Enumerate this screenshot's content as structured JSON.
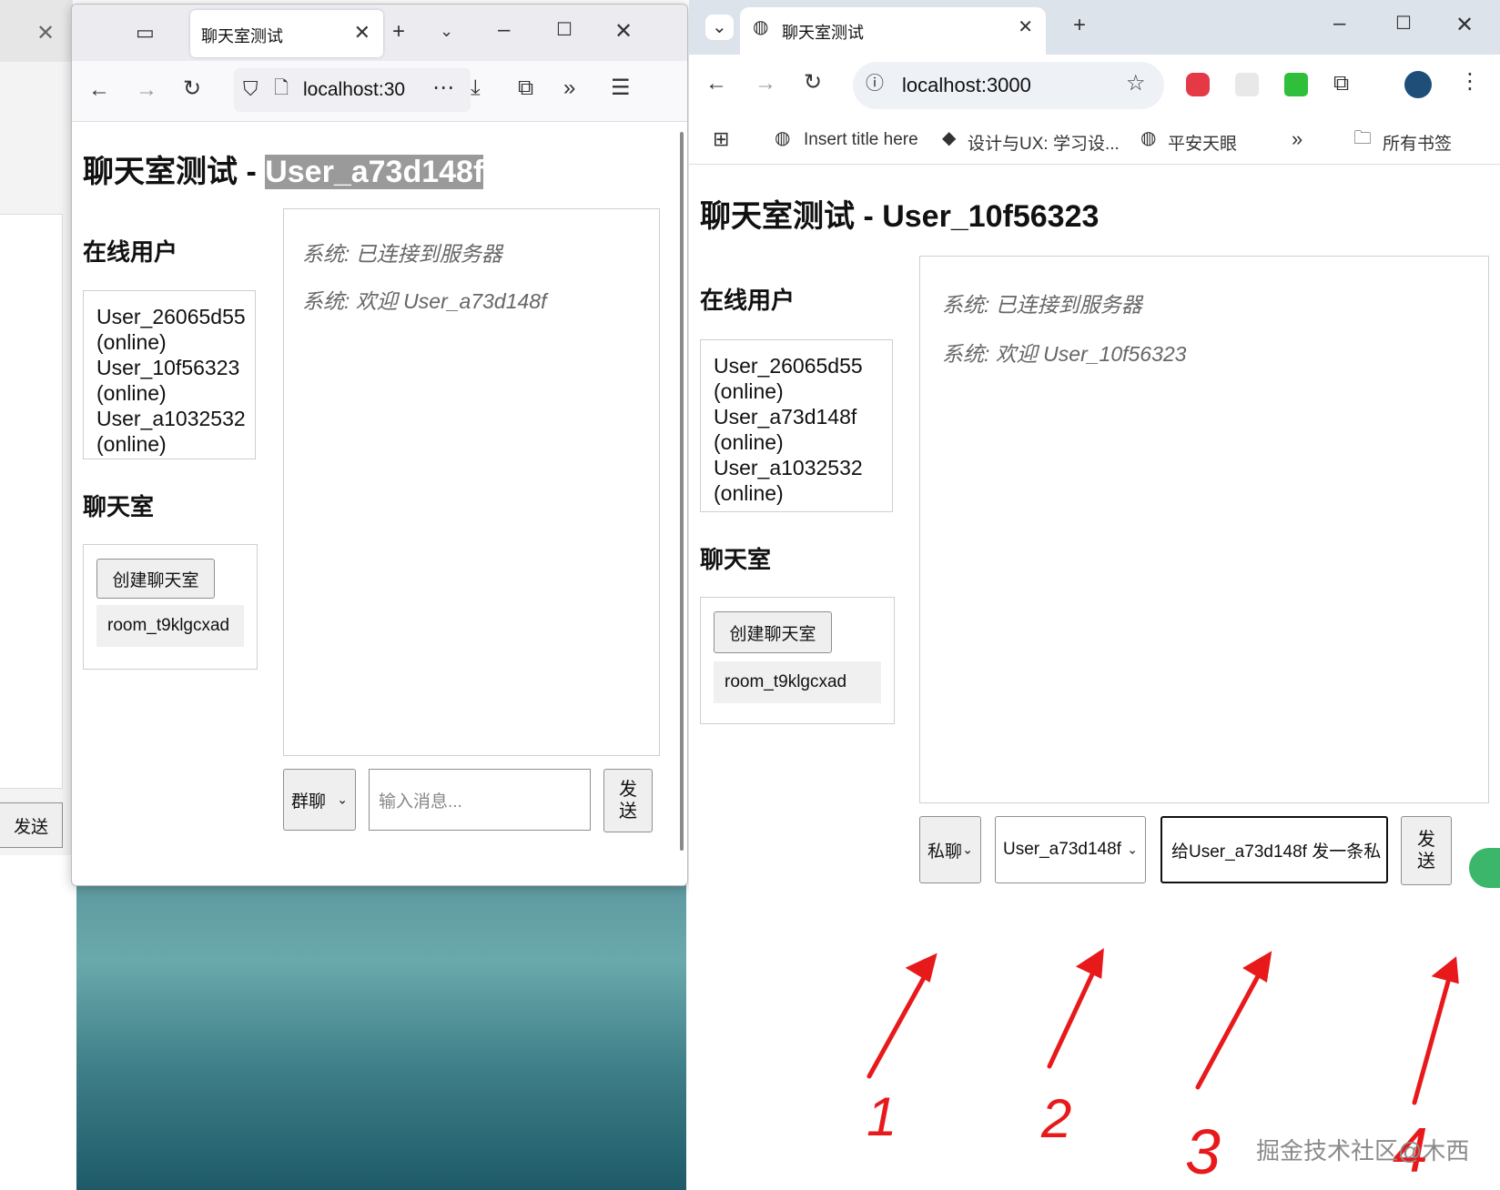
{
  "left_window": {
    "tab_title": "聊天室测试",
    "url_text": "localhost:30",
    "page": {
      "heading_prefix": "聊天室测试 - ",
      "heading_user": "User_a73d148f",
      "online_title": "在线用户",
      "users": [
        "User_26065d55",
        "(online)",
        "User_10f56323",
        "(online)",
        "User_a1032532",
        "(online)"
      ],
      "rooms_title": "聊天室",
      "create_room_label": "创建聊天室",
      "room_name": "room_t9klgcxad",
      "messages": [
        "系统: 已连接到服务器",
        "系统: 欢迎 User_a73d148f"
      ],
      "chat_mode": "群聊",
      "input_placeholder": "输入消息...",
      "send_label_1": "发",
      "send_label_2": "送"
    }
  },
  "background_window": {
    "send_label": "发送"
  },
  "right_window": {
    "tab_title": "聊天室测试",
    "url_text": "localhost:3000",
    "bookmarks": [
      "Insert title here",
      "设计与UX: 学习设...",
      "平安天眼"
    ],
    "all_bookmarks": "所有书签",
    "page": {
      "heading": "聊天室测试 - User_10f56323",
      "online_title": "在线用户",
      "users": [
        "User_26065d55",
        "(online)",
        "User_a73d148f",
        "(online)",
        "User_a1032532",
        "(online)"
      ],
      "rooms_title": "聊天室",
      "create_room_label": "创建聊天室",
      "room_name": "room_t9klgcxad",
      "messages": [
        "系统: 已连接到服务器",
        "系统: 欢迎 User_10f56323"
      ],
      "chat_mode": "私聊",
      "target_user": "User_a73d148f",
      "input_value": "给User_a73d148f 发一条私",
      "send_label_1": "发",
      "send_label_2": "送"
    }
  },
  "annotations": {
    "numbers": [
      "1",
      "2",
      "3",
      "4"
    ],
    "arrow_color": "#e8191b"
  },
  "watermark": "掘金技术社区@木西",
  "colors": {
    "firefox_tabbar": "#ecebf0",
    "chrome_tabbar": "#dde3ea",
    "selection": "#9a9a9a"
  }
}
